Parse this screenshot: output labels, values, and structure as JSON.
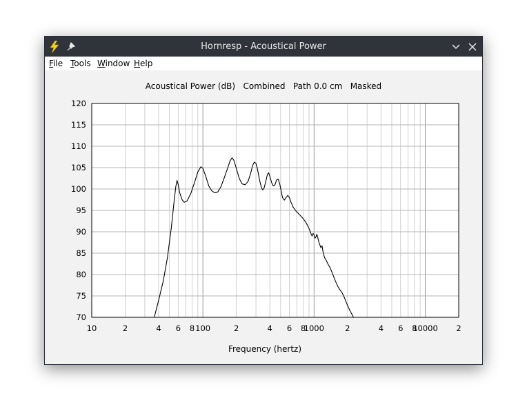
{
  "window": {
    "title": "Hornresp - Acoustical Power"
  },
  "menu": [
    "File",
    "Tools",
    "Window",
    "Help"
  ],
  "icons": {
    "app": "lightning-bolt-icon",
    "pin": "pin-icon",
    "minimize": "chevron-down-icon",
    "close": "close-icon"
  },
  "chart_data": {
    "type": "line",
    "title": "Acoustical Power (dB)   Combined   Path 0.0 cm   Masked",
    "xlabel": "Frequency (hertz)",
    "ylabel": "",
    "x_scale": "log",
    "xlim": [
      10,
      20000
    ],
    "ylim": [
      70,
      120
    ],
    "grid": true,
    "y_ticks": [
      120,
      115,
      110,
      105,
      100,
      95,
      90,
      85,
      80,
      75,
      70
    ],
    "x_ticks": [
      {
        "value": 10,
        "label": "10"
      },
      {
        "value": 20,
        "label": "2"
      },
      {
        "value": 40,
        "label": "4"
      },
      {
        "value": 60,
        "label": "6"
      },
      {
        "value": 80,
        "label": "8"
      },
      {
        "value": 100,
        "label": "100"
      },
      {
        "value": 200,
        "label": "2"
      },
      {
        "value": 400,
        "label": "4"
      },
      {
        "value": 600,
        "label": "6"
      },
      {
        "value": 800,
        "label": "8"
      },
      {
        "value": 1000,
        "label": "1000"
      },
      {
        "value": 2000,
        "label": "2"
      },
      {
        "value": 4000,
        "label": "4"
      },
      {
        "value": 6000,
        "label": "6"
      },
      {
        "value": 8000,
        "label": "8"
      },
      {
        "value": 10000,
        "label": "10000"
      },
      {
        "value": 20000,
        "label": "2"
      }
    ],
    "series": [
      {
        "color": "#000000",
        "points": [
          [
            36.5,
            70
          ],
          [
            40,
            74
          ],
          [
            44,
            78.5
          ],
          [
            48,
            84
          ],
          [
            52,
            91
          ],
          [
            55,
            97
          ],
          [
            57,
            100.5
          ],
          [
            58.5,
            102
          ],
          [
            60,
            101
          ],
          [
            62,
            99
          ],
          [
            65,
            97.5
          ],
          [
            68,
            96.9
          ],
          [
            72,
            97.2
          ],
          [
            78,
            99
          ],
          [
            84,
            101.5
          ],
          [
            90,
            104
          ],
          [
            96,
            105.2
          ],
          [
            100,
            104.8
          ],
          [
            106,
            103
          ],
          [
            113,
            100.7
          ],
          [
            120,
            99.6
          ],
          [
            128,
            99.1
          ],
          [
            136,
            99.3
          ],
          [
            145,
            100.5
          ],
          [
            155,
            102.5
          ],
          [
            165,
            104.5
          ],
          [
            175,
            106.5
          ],
          [
            183,
            107.3
          ],
          [
            190,
            106.7
          ],
          [
            200,
            104.8
          ],
          [
            212,
            102.5
          ],
          [
            225,
            101.2
          ],
          [
            240,
            101.0
          ],
          [
            255,
            101.8
          ],
          [
            268,
            103.5
          ],
          [
            280,
            105.5
          ],
          [
            290,
            106.3
          ],
          [
            300,
            106.0
          ],
          [
            310,
            104.6
          ],
          [
            322,
            102.3
          ],
          [
            335,
            100.4
          ],
          [
            345,
            99.8
          ],
          [
            355,
            100.2
          ],
          [
            368,
            101.8
          ],
          [
            380,
            103.4
          ],
          [
            390,
            103.8
          ],
          [
            400,
            103.0
          ],
          [
            415,
            101.5
          ],
          [
            430,
            100.7
          ],
          [
            445,
            101.0
          ],
          [
            460,
            102.1
          ],
          [
            475,
            102.3
          ],
          [
            490,
            101.3
          ],
          [
            505,
            99.6
          ],
          [
            520,
            98.0
          ],
          [
            540,
            97.4
          ],
          [
            560,
            98.0
          ],
          [
            580,
            98.5
          ],
          [
            600,
            98.0
          ],
          [
            620,
            96.9
          ],
          [
            650,
            95.7
          ],
          [
            690,
            94.8
          ],
          [
            740,
            94.0
          ],
          [
            790,
            93.2
          ],
          [
            840,
            92.3
          ],
          [
            880,
            91.3
          ],
          [
            910,
            90.5
          ],
          [
            940,
            89.5
          ],
          [
            960,
            89.0
          ],
          [
            980,
            89.6
          ],
          [
            1000,
            89.3
          ],
          [
            1020,
            88.5
          ],
          [
            1040,
            88.8
          ],
          [
            1060,
            89.4
          ],
          [
            1080,
            88.6
          ],
          [
            1110,
            87.4
          ],
          [
            1150,
            86.3
          ],
          [
            1180,
            86.7
          ],
          [
            1200,
            85.5
          ],
          [
            1240,
            84.0
          ],
          [
            1280,
            83.4
          ],
          [
            1330,
            82.5
          ],
          [
            1380,
            81.8
          ],
          [
            1430,
            80.9
          ],
          [
            1490,
            79.7
          ],
          [
            1560,
            78.4
          ],
          [
            1630,
            77.3
          ],
          [
            1700,
            76.5
          ],
          [
            1780,
            75.8
          ],
          [
            1860,
            74.8
          ],
          [
            1940,
            73.6
          ],
          [
            2020,
            72.5
          ],
          [
            2100,
            71.6
          ],
          [
            2200,
            70.6
          ],
          [
            2260,
            70
          ]
        ]
      }
    ]
  }
}
